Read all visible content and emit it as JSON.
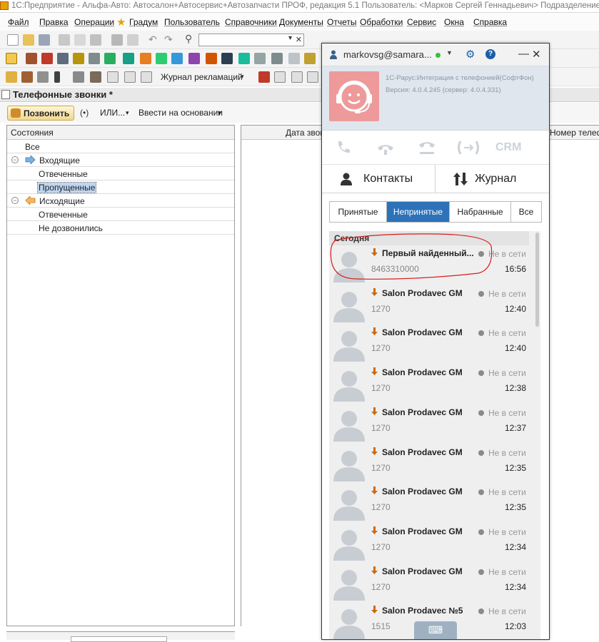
{
  "titlebar": {
    "text": "1С:Предприятие - Альфа-Авто: Автосалон+Автосервис+Автозапчасти ПРОФ, редакция 5.1    Пользователь: <Марков Сергей Геннадьевич>    Подразделение:"
  },
  "menu": [
    "Файл",
    "Правка",
    "Операции",
    "Градум",
    "Пользователь",
    "Справочники",
    "Документы",
    "Отчеты",
    "Обработки",
    "Сервис",
    "Окна",
    "Справка"
  ],
  "toolbar3": {
    "journal": "Журнал рекламаций"
  },
  "document": {
    "title": "Телефонные звонки *"
  },
  "formbar": {
    "call": "Позвонить",
    "or": "ИЛИ...",
    "based_on": "Ввести на основании"
  },
  "states": {
    "header": "Состояния",
    "rows": [
      {
        "label": "Все"
      },
      {
        "label": "Входящие"
      },
      {
        "label": "Отвеченные"
      },
      {
        "label": "Пропущенные"
      },
      {
        "label": "Исходящие"
      },
      {
        "label": "Отвеченные"
      },
      {
        "label": "Не дозвонились"
      }
    ]
  },
  "grid": {
    "col_date": "Дата звонка",
    "col_number": "Номер телефона"
  },
  "softphone": {
    "account": "markovsg@samara...",
    "status_color": "#3cbe3c",
    "product": "1С-Рарус:Интеграция с телефонией(СофтФон)",
    "version": "Версия: 4.0.4.245 (сервер: 4.0.4.331)",
    "crm": "CRM",
    "nav": {
      "contacts": "Контакты",
      "journal": "Журнал"
    },
    "filters": [
      "Принятые",
      "Непринятые",
      "Набранные",
      "Все"
    ],
    "active_filter": "Непринятые",
    "day": "Сегодня",
    "accent": "#2d72b8",
    "calls": [
      {
        "name": "Первый найденный...",
        "status": "Не в сети",
        "number": "8463310000",
        "time": "16:56"
      },
      {
        "name": "Salon Prodavec GM",
        "status": "Не в сети",
        "number": "1270",
        "time": "12:40"
      },
      {
        "name": "Salon Prodavec GM",
        "status": "Не в сети",
        "number": "1270",
        "time": "12:40"
      },
      {
        "name": "Salon Prodavec GM",
        "status": "Не в сети",
        "number": "1270",
        "time": "12:38"
      },
      {
        "name": "Salon Prodavec GM",
        "status": "Не в сети",
        "number": "1270",
        "time": "12:37"
      },
      {
        "name": "Salon Prodavec GM",
        "status": "Не в сети",
        "number": "1270",
        "time": "12:35"
      },
      {
        "name": "Salon Prodavec GM",
        "status": "Не в сети",
        "number": "1270",
        "time": "12:35"
      },
      {
        "name": "Salon Prodavec GM",
        "status": "Не в сети",
        "number": "1270",
        "time": "12:34"
      },
      {
        "name": "Salon Prodavec GM",
        "status": "Не в сети",
        "number": "1270",
        "time": "12:34"
      },
      {
        "name": "Salon Prodavec №5",
        "status": "Не в сети",
        "number": "1515",
        "time": "12:03"
      }
    ]
  }
}
